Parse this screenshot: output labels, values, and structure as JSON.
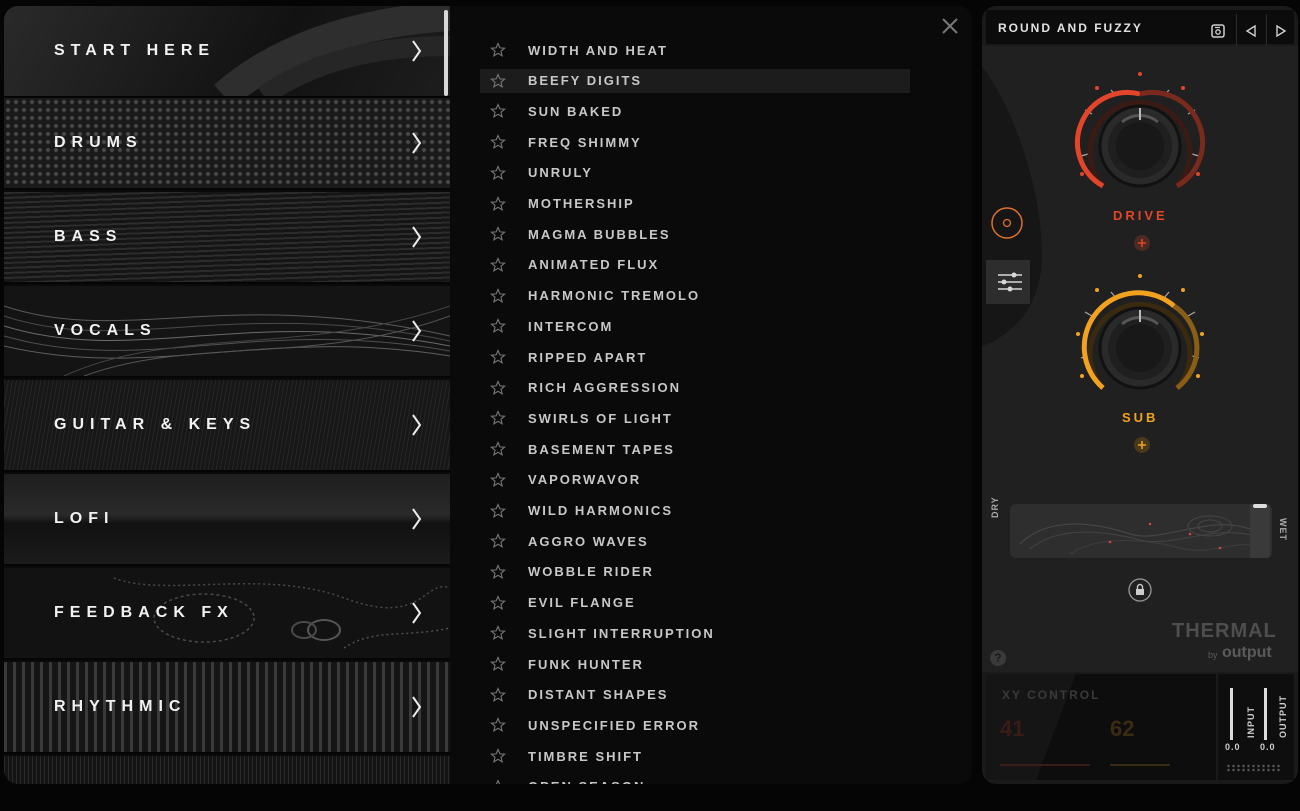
{
  "categories": [
    {
      "label": "START HERE"
    },
    {
      "label": "DRUMS"
    },
    {
      "label": "BASS"
    },
    {
      "label": "VOCALS"
    },
    {
      "label": "GUITAR & KEYS"
    },
    {
      "label": "LOFI"
    },
    {
      "label": "FEEDBACK FX"
    },
    {
      "label": "RHYTHMIC"
    }
  ],
  "presets": [
    "WIDTH AND HEAT",
    "BEEFY DIGITS",
    "SUN BAKED",
    "FREQ SHIMMY",
    "UNRULY",
    "MOTHERSHIP",
    "MAGMA BUBBLES",
    "ANIMATED FLUX",
    "HARMONIC TREMOLO",
    "INTERCOM",
    "RIPPED APART",
    "RICH AGGRESSION",
    "SWIRLS OF LIGHT",
    "BASEMENT TAPES",
    "VAPORWAVOR",
    "WILD HARMONICS",
    "AGGRO WAVES",
    "WOBBLE RIDER",
    "EVIL FLANGE",
    "SLIGHT INTERRUPTION",
    "FUNK HUNTER",
    "DISTANT SHAPES",
    "UNSPECIFIED ERROR",
    "TIMBRE SHIFT",
    "OPEN SEASON"
  ],
  "selected_preset": "BEEFY DIGITS",
  "plugin": {
    "preset_name": "ROUND AND FUZZY",
    "drive_label": "DRIVE",
    "sub_label": "SUB",
    "dry_label": "DRY",
    "wet_label": "WET",
    "brand_name": "THERMAL",
    "brand_by": "by",
    "brand_maker": "output",
    "xy_label": "XY CONTROL",
    "xy_value_1": "41",
    "xy_value_2": "62",
    "input_label": "INPUT",
    "output_label": "OUTPUT",
    "input_value": "0.0",
    "output_value": "0.0",
    "help_label": "?"
  },
  "colors": {
    "drive": "#e2452a",
    "sub": "#f2a21e",
    "panel": "#202020"
  }
}
